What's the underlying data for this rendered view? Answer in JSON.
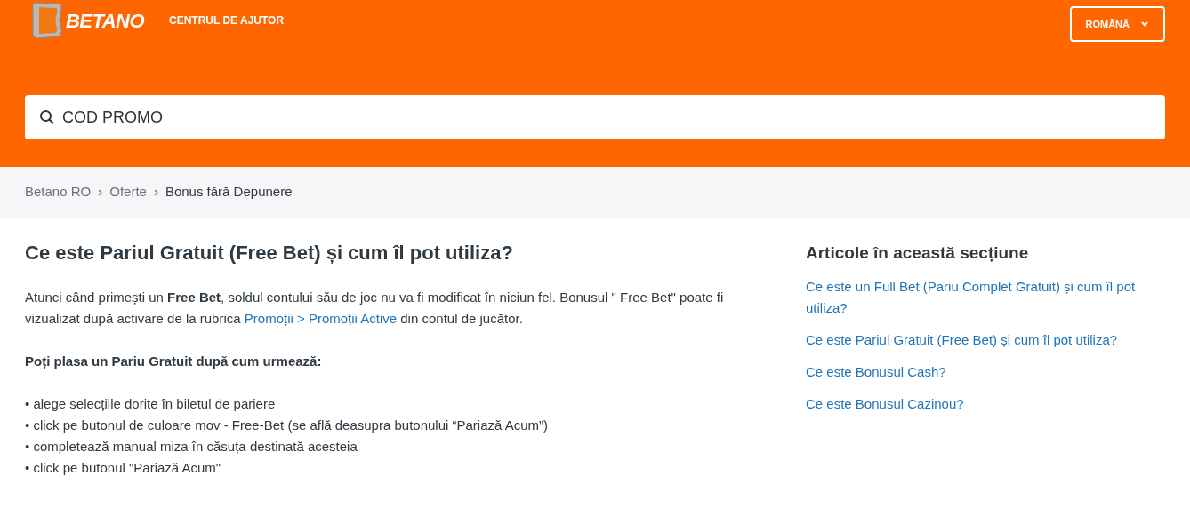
{
  "header": {
    "logo_text": "BETANO",
    "nav_link": "CENTRUL DE AJUTOR",
    "language_button": "ROMÂNĂ"
  },
  "search": {
    "value": "COD PROMO"
  },
  "breadcrumbs": [
    "Betano RO",
    "Oferte",
    "Bonus fără Depunere"
  ],
  "article": {
    "title": "Ce este Pariul Gratuit (Free Bet) și cum îl pot utiliza?",
    "intro": {
      "before": "Atunci când primești un **Free Bet**, soldul contului său de joc nu va fi modificat în niciun fel. Bonusul \" Free Bet\" poate fi vizualizat după activare de la rubrica ",
      "link": "Promoții > Promoții Active",
      "after": " din contul de jucător."
    },
    "steps_heading": "Poți plasa un Pariu Gratuit după cum urmează:",
    "steps": [
      "• alege selecțiile dorite în biletul de pariere",
      "• click pe butonul de culoare mov - Free-Bet (se află deasupra butonului “Pariază Acum”)",
      "• completează manual miza în căsuța destinată acesteia",
      "• click pe butonul \"Pariază Acum\""
    ]
  },
  "sidebar": {
    "title": "Articole în această secțiune",
    "links": [
      "Ce este un Full Bet (Pariu Complet Gratuit) și cum îl pot utiliza?",
      "Ce este Pariul Gratuit (Free Bet) și cum îl pot utiliza?",
      "Ce este Bonusul Cash?",
      "Ce este Bonusul Cazinou?"
    ]
  }
}
